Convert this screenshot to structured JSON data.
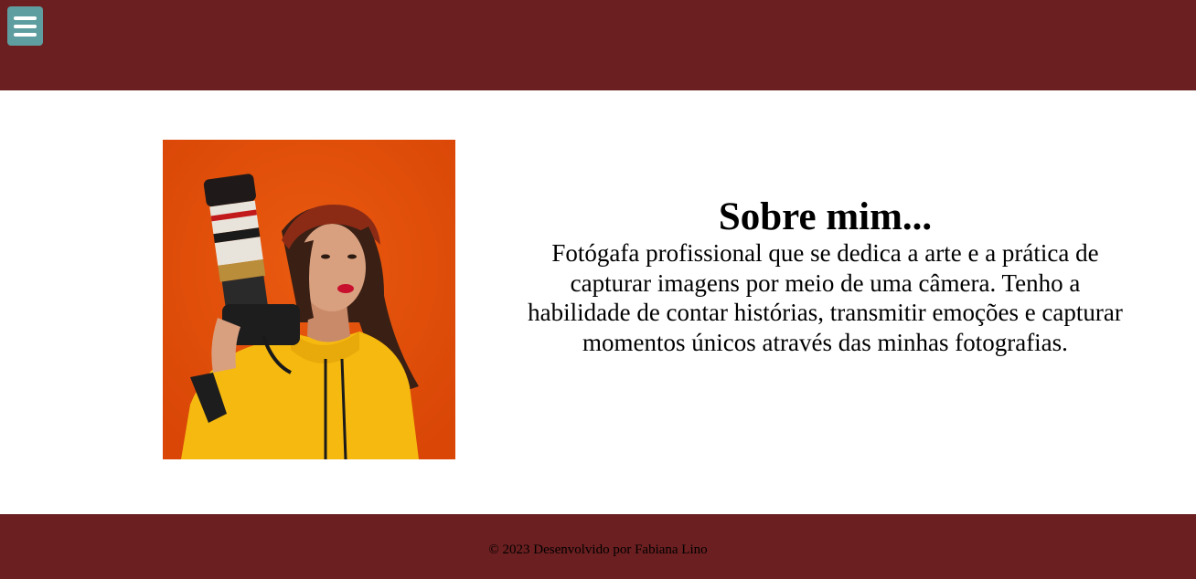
{
  "header": {
    "menu_icon": "hamburger-menu-icon",
    "background_color": "#6b1f20",
    "menu_button_color": "#5f9ea0"
  },
  "about": {
    "title": "Sobre mim...",
    "text": "Fotógafa profissional que se dedica a arte e a prática de capturar imagens por meio de uma câmera. Tenho a habilidade de contar histórias, transmitir emoções e capturar momentos únicos através das minhas fotografias."
  },
  "photo": {
    "background_color": "#e24e08",
    "shirt_color": "#f6b910"
  },
  "footer": {
    "copyright": "© 2023 Desenvolvido por Fabiana Lino"
  }
}
